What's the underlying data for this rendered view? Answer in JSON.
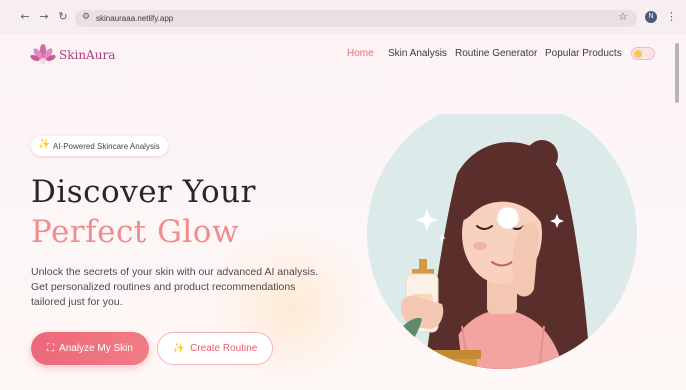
{
  "browser": {
    "url": "skinauraaa.netlify.app",
    "back_icon": "←",
    "forward_icon": "→",
    "reload_icon": "↻",
    "site_info_icon": "⚙",
    "bookmark_icon": "☆",
    "profile_initial": "N",
    "menu_icon": "⋮"
  },
  "site": {
    "brand": "SkinAura",
    "nav": [
      {
        "label": "Home",
        "active": true
      },
      {
        "label": "Skin Analysis",
        "active": false
      },
      {
        "label": "Routine Generator",
        "active": false
      },
      {
        "label": "Popular Products",
        "active": false
      }
    ]
  },
  "hero": {
    "badge": "AI-Powered Skincare Analysis",
    "badge_icon": "✨",
    "title_line1": "Discover Your",
    "title_line2": "Perfect Glow",
    "lede_lines": [
      "Unlock the secrets of your skin with our advanced AI analysis.",
      "Get personalized routines and product recommendations",
      "tailored just for you."
    ],
    "primary_button": "Analyze My Skin",
    "primary_icon": "⛶",
    "secondary_button": "Create Routine",
    "secondary_icon": "✨"
  },
  "colors": {
    "accent": "#ec6878",
    "accent_text": "#f08c8c",
    "brand": "#b0407f",
    "heading": "#2a2628"
  }
}
